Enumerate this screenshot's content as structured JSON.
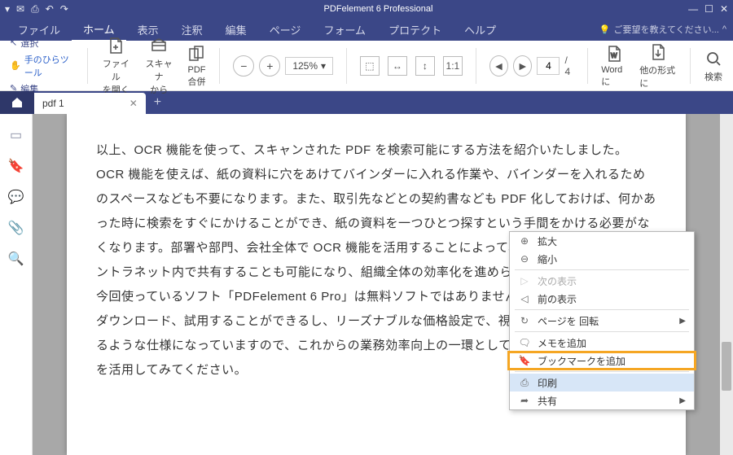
{
  "app": {
    "title": "PDFelement 6 Professional"
  },
  "menubar": {
    "items": [
      "ファイル",
      "ホーム",
      "表示",
      "注釈",
      "編集",
      "ページ",
      "フォーム",
      "プロテクト",
      "ヘルプ"
    ],
    "active_index": 1,
    "feedback": "ご要望を教えてください..."
  },
  "ribbon": {
    "side": {
      "select": "選択",
      "hand": "手のひらツール",
      "edit": "編集"
    },
    "file_open": "ファイル\nを開く",
    "scan_from": "スキャナ\nから",
    "pdf_merge": "PDF\n合併",
    "zoom": "125%",
    "page_current": "4",
    "page_total": "/ 4",
    "to_word": "Wordに",
    "to_other": "他の形式に",
    "search": "検索"
  },
  "tabs": {
    "doc_name": "pdf 1"
  },
  "page_text": {
    "l1": "以上、OCR 機能を使って、スキャンされた PDF を検索可能にする方法を紹介いたしました。",
    "l2": "OCR 機能を使えば、紙の資料に穴をあけてバインダーに入れる作業や、バインダーを入れるためのスペースなども不要になります。また、取引先などとの契約書なども PDF 化しておけば、何かあった時に検索をすぐにかけることができ、紙の資料を一つひとつ探すという手間をかける必要がなくなります。部署や部門、会社全体で OCR 機能を活用することによって、",
    "l2b": "ントラネット内で共有することも可能になり、組織全体の効率化を進めら",
    "l3": "今回使っているソフト「PDFelement 6 Pro」は無料ソフトではありません",
    "l3b": "ダウンロード、試用することができるし、リーズナブルな価格設定で、視",
    "l3c": "るような仕様になっていますので、これからの業務効率向上の一環として、",
    "l4": "を活用してみてください。"
  },
  "ctx": {
    "zoom_in": "拡大",
    "zoom_out": "縮小",
    "next_view": "次の表示",
    "prev_view": "前の表示",
    "rotate": "ページを 回転",
    "add_memo": "メモを追加",
    "add_bookmark": "ブックマークを追加",
    "print": "印刷",
    "share": "共有"
  }
}
